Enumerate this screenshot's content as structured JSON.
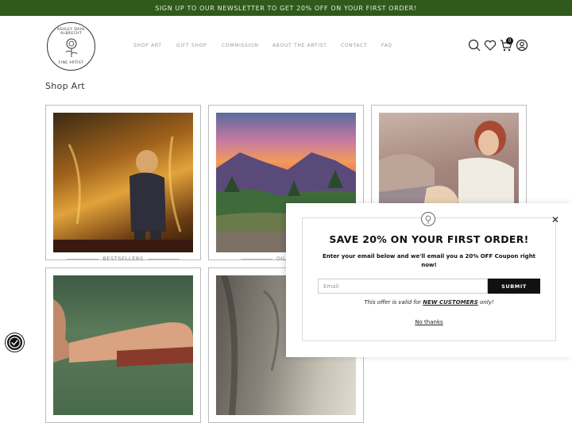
{
  "announcement": "SIGN UP TO OUR NEWSLETTER TO GET 20% OFF ON YOUR FIRST ORDER!",
  "logo": {
    "top_text": "ASHLEY DAHL ALBRECHT",
    "bottom_text": "FINE ARTIST"
  },
  "nav": [
    "SHOP ART",
    "GIFT SHOP",
    "COMMISSION",
    "ABOUT THE ARTIST",
    "CONTACT",
    "FAQ"
  ],
  "cart": {
    "count": "0"
  },
  "page_title": "Shop Art",
  "cards": [
    {
      "caption": "BESTSELLERS",
      "icon": "child-window-painting"
    },
    {
      "caption": "OIL PA",
      "icon": "mountain-sunset-painting"
    },
    {
      "caption": "",
      "icon": "mother-child-painting"
    },
    {
      "caption": "",
      "icon": "figure-painting"
    },
    {
      "caption": "",
      "icon": "sketch-painting"
    }
  ],
  "popup": {
    "title": "SAVE 20% ON YOUR FIRST ORDER!",
    "description": "Enter your email below and we'll email you a 20% OFF Coupon right now!",
    "email_placeholder": "Email",
    "submit_label": "SUBMIT",
    "offer_prefix": "This offer is valid for ",
    "offer_emphasis": "NEW CUSTOMERS",
    "offer_suffix": " only!",
    "no_thanks": "No thanks",
    "close": "✕"
  },
  "colors": {
    "topbar": "#2f5a1c",
    "button": "#111111"
  }
}
